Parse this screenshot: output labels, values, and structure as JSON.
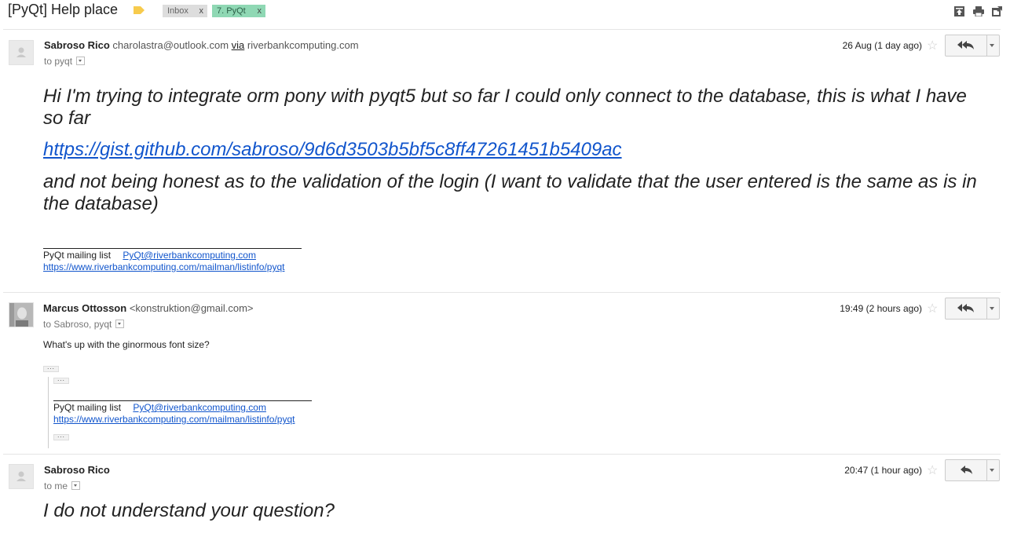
{
  "thread": {
    "subject": "[PyQt] Help place",
    "labels": [
      {
        "name": "Inbox",
        "remove": "x"
      },
      {
        "name": "7. PyQt",
        "remove": "x"
      }
    ]
  },
  "toolbar_icons": [
    "expand-all-icon",
    "print-icon",
    "new-window-icon"
  ],
  "messages": [
    {
      "sender_name": "Sabroso Rico",
      "sender_email": "charolastra@outlook.com",
      "via_label": "via",
      "via_domain": "riverbankcomputing.com",
      "recipients": "to pyqt",
      "date": "26 Aug (1 day ago)",
      "body_text_1": "Hi I'm trying to integrate orm pony with pyqt5 but so far I could only connect to the database, this is what I have so far",
      "body_link": "https://gist.github.com/sabroso/9d6d3503b5bf5c8ff47261451b5409ac",
      "body_text_2": "and not being honest as to the validation of the login (I want to validate that the user entered is the same as is in the database)",
      "footer_list": "PyQt mailing list",
      "footer_email": "PyQt@riverbankcomputing.com",
      "footer_url": "https://www.riverbankcomputing.com/mailman/listinfo/pyqt"
    },
    {
      "sender_name": "Marcus Ottosson",
      "sender_email": "<konstruktion@gmail.com>",
      "recipients": "to Sabroso, pyqt",
      "date": "19:49 (2 hours ago)",
      "body_text": "What's up with the ginormous font size?",
      "footer_list": "PyQt mailing list",
      "footer_email": "PyQt@riverbankcomputing.com",
      "footer_url": "https://www.riverbankcomputing.com/mailman/listinfo/pyqt"
    },
    {
      "sender_name": "Sabroso Rico",
      "recipients": "to me",
      "date": "20:47 (1 hour ago)",
      "body_text": "I do not understand your question?"
    }
  ],
  "colors": {
    "link": "#1155cc",
    "pyqt_label": "#8fd8b4",
    "important_marker": "#f7cb4d"
  }
}
